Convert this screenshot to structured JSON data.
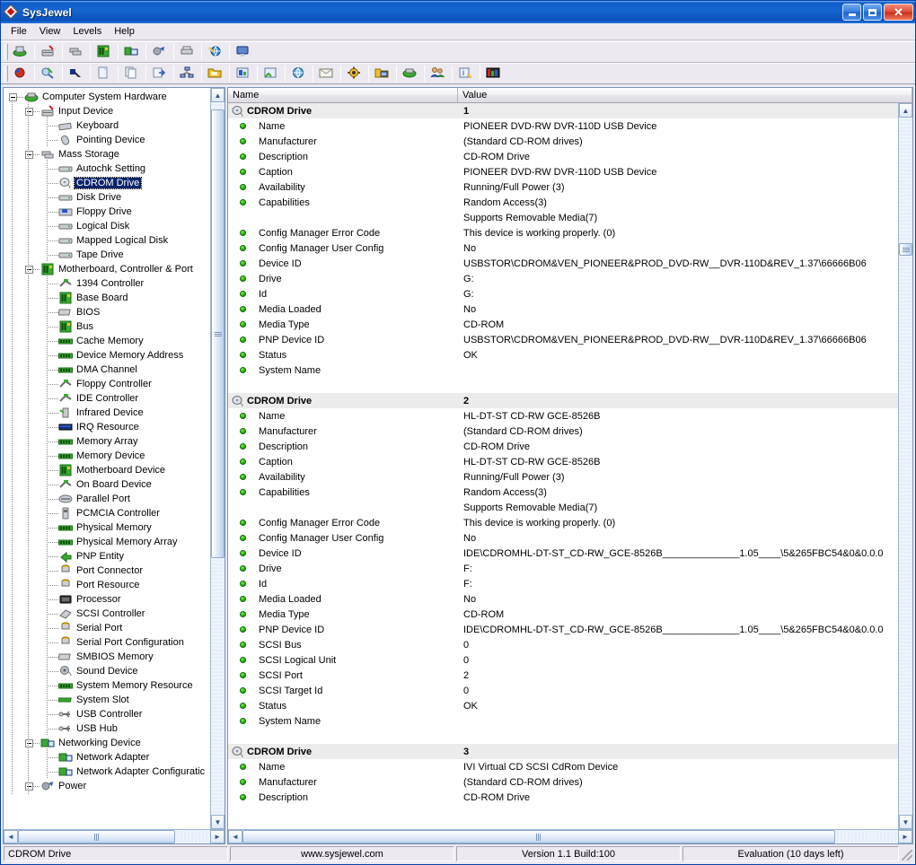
{
  "window": {
    "title": "SysJewel",
    "app_icon": "diamond-icon",
    "buttons": {
      "minimize": "minimize-icon",
      "maximize": "maximize-icon",
      "close": "close-icon"
    }
  },
  "menu": {
    "items": [
      "File",
      "View",
      "Levels",
      "Help"
    ]
  },
  "toolbar_rows": [
    {
      "groups": [
        [
          "hardware-summary-icon"
        ],
        [
          "input-device-icon"
        ],
        [
          "mass-storage-icon"
        ],
        [
          "motherboard-icon"
        ],
        [
          "networking-device-icon"
        ],
        [
          "power-icon"
        ],
        [
          "printer-icon"
        ],
        [
          "internet-icon"
        ],
        [
          "display-icon"
        ]
      ]
    },
    {
      "groups": [
        [
          "refresh-icon"
        ],
        [
          "search-icon"
        ],
        [
          "select-icon"
        ],
        [
          "new-document-icon"
        ],
        [
          "copy-icon"
        ],
        [
          "export-icon"
        ],
        [
          "network-map-icon"
        ],
        [
          "open-folder-icon"
        ],
        [
          "report-icon"
        ],
        [
          "shortcut-icon"
        ],
        [
          "globe-icon"
        ],
        [
          "mail-icon"
        ],
        [
          "settings-gear-icon"
        ],
        [
          "folder-share-icon"
        ],
        [
          "computer-icon"
        ],
        [
          "users-icon"
        ],
        [
          "info-book-icon"
        ],
        [
          "benchmark-icon"
        ]
      ]
    }
  ],
  "tree": {
    "items": [
      {
        "label": "Computer System Hardware",
        "depth": 0,
        "expander": "minus",
        "icon": "computer-icon"
      },
      {
        "label": "Input Device",
        "depth": 1,
        "expander": "minus",
        "icon": "input-device-icon"
      },
      {
        "label": "Keyboard",
        "depth": 2,
        "expander": "none",
        "icon": "keyboard-icon"
      },
      {
        "label": "Pointing Device",
        "depth": 2,
        "expander": "none",
        "icon": "mouse-icon"
      },
      {
        "label": "Mass Storage",
        "depth": 1,
        "expander": "minus",
        "icon": "mass-storage-icon"
      },
      {
        "label": "Autochk Setting",
        "depth": 2,
        "expander": "none",
        "icon": "drive-icon"
      },
      {
        "label": "CDROM Drive",
        "depth": 2,
        "expander": "none",
        "icon": "cdrom-icon",
        "selected": true
      },
      {
        "label": "Disk Drive",
        "depth": 2,
        "expander": "none",
        "icon": "drive-icon"
      },
      {
        "label": "Floppy Drive",
        "depth": 2,
        "expander": "none",
        "icon": "floppy-icon"
      },
      {
        "label": "Logical Disk",
        "depth": 2,
        "expander": "none",
        "icon": "drive-icon"
      },
      {
        "label": "Mapped Logical Disk",
        "depth": 2,
        "expander": "none",
        "icon": "drive-icon"
      },
      {
        "label": "Tape Drive",
        "depth": 2,
        "expander": "none",
        "icon": "drive-icon"
      },
      {
        "label": "Motherboard, Controller & Port",
        "depth": 1,
        "expander": "minus",
        "icon": "motherboard-icon"
      },
      {
        "label": "1394 Controller",
        "depth": 2,
        "expander": "none",
        "icon": "controller-icon"
      },
      {
        "label": "Base Board",
        "depth": 2,
        "expander": "none",
        "icon": "motherboard-icon"
      },
      {
        "label": "BIOS",
        "depth": 2,
        "expander": "none",
        "icon": "chip-icon"
      },
      {
        "label": "Bus",
        "depth": 2,
        "expander": "none",
        "icon": "motherboard-icon"
      },
      {
        "label": "Cache Memory",
        "depth": 2,
        "expander": "none",
        "icon": "memory-icon"
      },
      {
        "label": "Device Memory Address",
        "depth": 2,
        "expander": "none",
        "icon": "memory-icon"
      },
      {
        "label": "DMA Channel",
        "depth": 2,
        "expander": "none",
        "icon": "memory-icon"
      },
      {
        "label": "Floppy Controller",
        "depth": 2,
        "expander": "none",
        "icon": "controller-icon"
      },
      {
        "label": "IDE Controller",
        "depth": 2,
        "expander": "none",
        "icon": "controller-icon"
      },
      {
        "label": "Infrared Device",
        "depth": 2,
        "expander": "none",
        "icon": "infrared-icon"
      },
      {
        "label": "IRQ Resource",
        "depth": 2,
        "expander": "none",
        "icon": "irq-icon"
      },
      {
        "label": "Memory Array",
        "depth": 2,
        "expander": "none",
        "icon": "memory-icon"
      },
      {
        "label": "Memory Device",
        "depth": 2,
        "expander": "none",
        "icon": "memory-icon"
      },
      {
        "label": "Motherboard Device",
        "depth": 2,
        "expander": "none",
        "icon": "motherboard-icon"
      },
      {
        "label": "On Board Device",
        "depth": 2,
        "expander": "none",
        "icon": "controller-icon"
      },
      {
        "label": "Parallel Port",
        "depth": 2,
        "expander": "none",
        "icon": "port-icon"
      },
      {
        "label": "PCMCIA Controller",
        "depth": 2,
        "expander": "none",
        "icon": "pcmcia-icon"
      },
      {
        "label": "Physical Memory",
        "depth": 2,
        "expander": "none",
        "icon": "memory-icon"
      },
      {
        "label": "Physical Memory Array",
        "depth": 2,
        "expander": "none",
        "icon": "memory-icon"
      },
      {
        "label": "PNP Entity",
        "depth": 2,
        "expander": "none",
        "icon": "pnp-icon"
      },
      {
        "label": "Port Connector",
        "depth": 2,
        "expander": "none",
        "icon": "connector-icon"
      },
      {
        "label": "Port Resource",
        "depth": 2,
        "expander": "none",
        "icon": "connector-icon"
      },
      {
        "label": "Processor",
        "depth": 2,
        "expander": "none",
        "icon": "processor-icon"
      },
      {
        "label": "SCSI Controller",
        "depth": 2,
        "expander": "none",
        "icon": "scsi-icon"
      },
      {
        "label": "Serial Port",
        "depth": 2,
        "expander": "none",
        "icon": "connector-icon"
      },
      {
        "label": "Serial Port Configuration",
        "depth": 2,
        "expander": "none",
        "icon": "connector-icon"
      },
      {
        "label": "SMBIOS Memory",
        "depth": 2,
        "expander": "none",
        "icon": "chip-icon"
      },
      {
        "label": "Sound Device",
        "depth": 2,
        "expander": "none",
        "icon": "sound-icon"
      },
      {
        "label": "System Memory Resource",
        "depth": 2,
        "expander": "none",
        "icon": "memory-icon"
      },
      {
        "label": "System Slot",
        "depth": 2,
        "expander": "none",
        "icon": "slot-icon"
      },
      {
        "label": "USB Controller",
        "depth": 2,
        "expander": "none",
        "icon": "usb-icon"
      },
      {
        "label": "USB Hub",
        "depth": 2,
        "expander": "none",
        "icon": "usb-icon"
      },
      {
        "label": "Networking Device",
        "depth": 1,
        "expander": "minus",
        "icon": "network-icon"
      },
      {
        "label": "Network Adapter",
        "depth": 2,
        "expander": "none",
        "icon": "network-icon"
      },
      {
        "label": "Network Adapter Configuratic",
        "depth": 2,
        "expander": "none",
        "icon": "network-icon"
      },
      {
        "label": "Power",
        "depth": 1,
        "expander": "minus",
        "icon": "power-icon"
      }
    ]
  },
  "list": {
    "columns": {
      "name": "Name",
      "value": "Value"
    },
    "rows": [
      {
        "type": "group",
        "name": "CDROM Drive",
        "value": "1",
        "icon": "cdrom-icon"
      },
      {
        "type": "item",
        "name": "Name",
        "value": "PIONEER DVD-RW  DVR-110D USB Device"
      },
      {
        "type": "item",
        "name": "Manufacturer",
        "value": "(Standard CD-ROM drives)"
      },
      {
        "type": "item",
        "name": "Description",
        "value": "CD-ROM Drive"
      },
      {
        "type": "item",
        "name": "Caption",
        "value": "PIONEER DVD-RW  DVR-110D USB Device"
      },
      {
        "type": "item",
        "name": "Availability",
        "value": "Running/Full Power (3)"
      },
      {
        "type": "item",
        "name": "Capabilities",
        "value": "Random Access(3)"
      },
      {
        "type": "cont",
        "name": "",
        "value": "Supports Removable Media(7)"
      },
      {
        "type": "item",
        "name": "Config Manager Error Code",
        "value": "This device is working properly. (0)"
      },
      {
        "type": "item",
        "name": "Config Manager User Config",
        "value": "No"
      },
      {
        "type": "item",
        "name": "Device ID",
        "value": "USBSTOR\\CDROM&VEN_PIONEER&PROD_DVD-RW__DVR-110D&REV_1.37\\66666B06"
      },
      {
        "type": "item",
        "name": "Drive",
        "value": "G:"
      },
      {
        "type": "item",
        "name": "Id",
        "value": "G:"
      },
      {
        "type": "item",
        "name": "Media Loaded",
        "value": "No"
      },
      {
        "type": "item",
        "name": "Media Type",
        "value": "CD-ROM"
      },
      {
        "type": "item",
        "name": "PNP Device ID",
        "value": "USBSTOR\\CDROM&VEN_PIONEER&PROD_DVD-RW__DVR-110D&REV_1.37\\66666B06"
      },
      {
        "type": "item",
        "name": "Status",
        "value": "OK"
      },
      {
        "type": "item",
        "name": "System Name",
        "value": ""
      },
      {
        "type": "blank",
        "name": "",
        "value": ""
      },
      {
        "type": "group",
        "name": "CDROM Drive",
        "value": "2",
        "icon": "cdrom-icon"
      },
      {
        "type": "item",
        "name": "Name",
        "value": "HL-DT-ST CD-RW GCE-8526B"
      },
      {
        "type": "item",
        "name": "Manufacturer",
        "value": "(Standard CD-ROM drives)"
      },
      {
        "type": "item",
        "name": "Description",
        "value": "CD-ROM Drive"
      },
      {
        "type": "item",
        "name": "Caption",
        "value": "HL-DT-ST CD-RW GCE-8526B"
      },
      {
        "type": "item",
        "name": "Availability",
        "value": "Running/Full Power (3)"
      },
      {
        "type": "item",
        "name": "Capabilities",
        "value": "Random Access(3)"
      },
      {
        "type": "cont",
        "name": "",
        "value": "Supports Removable Media(7)"
      },
      {
        "type": "item",
        "name": "Config Manager Error Code",
        "value": "This device is working properly. (0)"
      },
      {
        "type": "item",
        "name": "Config Manager User Config",
        "value": "No"
      },
      {
        "type": "item",
        "name": "Device ID",
        "value": "IDE\\CDROMHL-DT-ST_CD-RW_GCE-8526B______________1.05____\\5&265FBC54&0&0.0.0"
      },
      {
        "type": "item",
        "name": "Drive",
        "value": "F:"
      },
      {
        "type": "item",
        "name": "Id",
        "value": "F:"
      },
      {
        "type": "item",
        "name": "Media Loaded",
        "value": "No"
      },
      {
        "type": "item",
        "name": "Media Type",
        "value": "CD-ROM"
      },
      {
        "type": "item",
        "name": "PNP Device ID",
        "value": "IDE\\CDROMHL-DT-ST_CD-RW_GCE-8526B______________1.05____\\5&265FBC54&0&0.0.0"
      },
      {
        "type": "item",
        "name": "SCSI Bus",
        "value": "0"
      },
      {
        "type": "item",
        "name": "SCSI Logical Unit",
        "value": "0"
      },
      {
        "type": "item",
        "name": "SCSI Port",
        "value": "2"
      },
      {
        "type": "item",
        "name": "SCSI Target Id",
        "value": "0"
      },
      {
        "type": "item",
        "name": "Status",
        "value": "OK"
      },
      {
        "type": "item",
        "name": "System Name",
        "value": ""
      },
      {
        "type": "blank",
        "name": "",
        "value": ""
      },
      {
        "type": "group",
        "name": "CDROM Drive",
        "value": "3",
        "icon": "cdrom-icon"
      },
      {
        "type": "item",
        "name": "Name",
        "value": "IVI Virtual CD SCSI CdRom Device"
      },
      {
        "type": "item",
        "name": "Manufacturer",
        "value": "(Standard CD-ROM drives)"
      },
      {
        "type": "item",
        "name": "Description",
        "value": "CD-ROM Drive"
      }
    ]
  },
  "statusbar": {
    "selection": "CDROM Drive",
    "website": "www.sysjewel.com",
    "version": "Version 1.1 Build:100",
    "license": "Evaluation (10 days left)"
  },
  "scrollbars": {
    "tree_up": "▲",
    "tree_down": "▼",
    "tree_left": "◄",
    "tree_right": "►",
    "list_up": "▲",
    "list_down": "▼",
    "list_left": "◄",
    "list_right": "►"
  },
  "colors": {
    "accent": "#0a55c8",
    "selection": "#0a246a",
    "status_ok": "#2fc310",
    "group_row": "#ececec"
  }
}
